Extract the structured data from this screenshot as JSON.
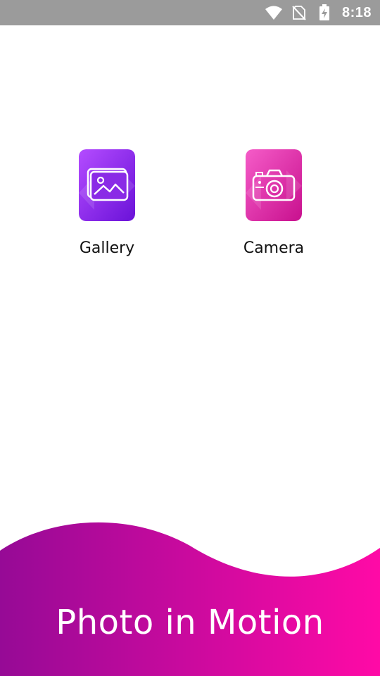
{
  "status_bar": {
    "time": "8:18",
    "icons": [
      "wifi-icon",
      "no-sim-icon",
      "battery-charging-icon"
    ]
  },
  "tiles": [
    {
      "label": "Gallery",
      "icon": "gallery-icon",
      "gradient": [
        "#b44cff",
        "#6a12d8"
      ]
    },
    {
      "label": "Camera",
      "icon": "camera-icon",
      "gradient": [
        "#f55cc8",
        "#c8108e"
      ]
    }
  ],
  "footer": {
    "title": "Photo in Motion",
    "gradient": [
      "#960a96",
      "#ff0aa6"
    ]
  },
  "colors": {
    "status_bar_bg": "#9b9b9b",
    "background": "#ffffff"
  }
}
